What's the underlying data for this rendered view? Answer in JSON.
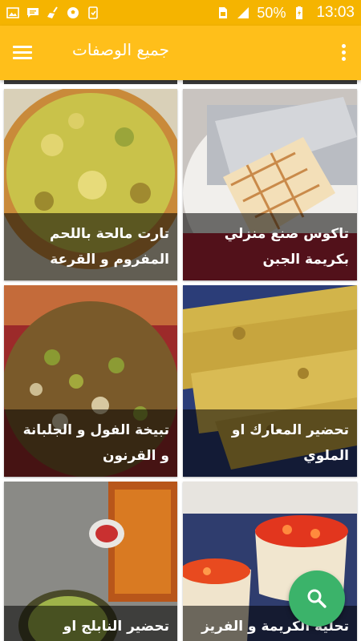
{
  "status_bar": {
    "left_icons": [
      "image-icon",
      "chat-icon",
      "broom-icon",
      "soccer-icon",
      "tablet-icon"
    ],
    "right_icons": [
      "sim-icon",
      "signal-icon",
      "battery-icon"
    ],
    "battery_text": "50%",
    "time": "13:03"
  },
  "app_bar": {
    "title": "جميع الوصفات",
    "menu_icon": "hamburger-menu-icon",
    "overflow_icon": "more-vert-icon"
  },
  "recipes": [
    {
      "title": "تاكوس صنع منزلي بكريمة الجبن"
    },
    {
      "title": "تارت مالحة باللحم المفروم و القرعة"
    },
    {
      "title": "تحضير المعارك او الملوي"
    },
    {
      "title": "تبيخة الفول و الجلبانة و القرنون"
    },
    {
      "title": "تحلية الكريمة و الفريز"
    },
    {
      "title": "تحضير النابلج او"
    }
  ],
  "fab": {
    "icon": "search-icon"
  },
  "colors": {
    "status_bar": "#f5b400",
    "app_bar": "#ffbf1a",
    "fab": "#3bb36a",
    "caption_overlay": "rgba(0,0,0,0.55)"
  }
}
